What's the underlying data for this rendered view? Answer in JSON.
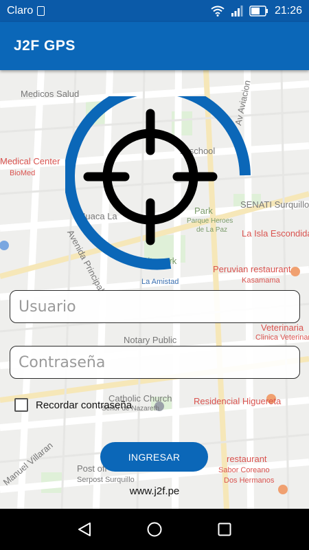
{
  "status_bar": {
    "carrier": "Claro",
    "time": "21:26",
    "icons": [
      "sim-icon",
      "wifi-icon",
      "signal-icon",
      "battery-icon"
    ]
  },
  "app_bar": {
    "title": "J2F GPS"
  },
  "login": {
    "username_placeholder": "Usuario",
    "username_value": "",
    "password_placeholder": "Contraseña",
    "password_value": "",
    "remember_label": "Recordar contraseña",
    "remember_checked": false,
    "submit_label": "INGRESAR",
    "website": "www.j2f.pe"
  },
  "map_labels": {
    "medicos": "Medicos Salud",
    "medical_center": "Medical Center",
    "biomed": "BioMed",
    "huaca": "Huaca La",
    "park": "Park",
    "parque": "Parque Heroes",
    "de_la_paz": "de La Paz",
    "senati": "SENATI Surquillo",
    "isla": "La Isla Escondida",
    "city_park": "City park",
    "amistad": "La Amistad",
    "peruvian": "Peruvian restaurant",
    "kasamama": "Kasamama",
    "notary": "Notary Public",
    "veterinaria": "Veterinaria",
    "clinica": "Clinica Veterinaria",
    "catholic": "Catholic Church",
    "nazareth": "Señor de Nazareth",
    "residencial": "Residencial Higuereta",
    "post": "Post off",
    "serpost": "Serpost Surquillo",
    "restaurant": "restaurant",
    "sabor": "Sabor Coreano",
    "hermanos": "Dos Hermanos",
    "school": "st school",
    "manuel": "Manuel Villaran",
    "avenida": "Avenida Principal",
    "aviacion": "Av Aviacion"
  },
  "colors": {
    "primary": "#0b67b8",
    "status_bar": "#0b5aa8",
    "nav_bar": "#000000"
  }
}
